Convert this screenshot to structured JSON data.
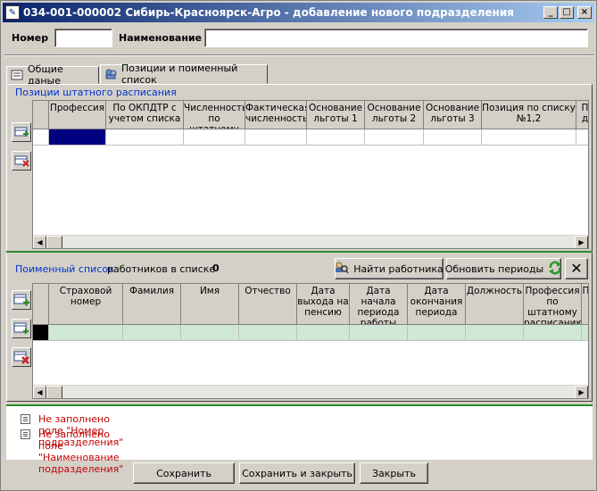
{
  "window": {
    "title": "034-001-000002 Сибирь-Красноярск-Агро - добавление нового подразделения",
    "controls": {
      "minimize": "_",
      "maximize": "□",
      "close": "×"
    }
  },
  "form": {
    "number_label": "Номер",
    "number_value": "",
    "name_label": "Наименование",
    "name_value": ""
  },
  "tabs": [
    {
      "label": "Общие даные",
      "icon": "document-icon"
    },
    {
      "label": "Позиции и поименный список",
      "icon": "users-icon"
    }
  ],
  "positions": {
    "caption": "Позиции штатного расписания",
    "columns": [
      "Профессия",
      "По ОКПДТР с\nучетом списка",
      "Численность\nпо штатному",
      "Фактическая\nчисленность",
      "Основание\nльготы 1",
      "Основание\nльготы 2",
      "Основание\nльготы 3",
      "Позиция по списку\n№1,2",
      "П\nд"
    ]
  },
  "employees": {
    "caption_link": "Поименный список",
    "count_label": "работников в списке",
    "count": "0",
    "find_button": "Найти работника",
    "update_button": "Обновить периоды",
    "columns": [
      "Страховой\nномер",
      "Фамилия",
      "Имя",
      "Отчество",
      "Дата\nвыхода на\nпенсию",
      "Дата начала\nпериода\nработы",
      "Дата\nокончания\nпериода",
      "Должность",
      "Профессия\nпо штатному\nрасписанию",
      "П"
    ]
  },
  "messages": [
    "Не заполнено поле \"Номер подразделения\"",
    "Не заполнено поле \"Наименование подразделения\""
  ],
  "footer": {
    "save": "Сохранить",
    "save_close": "Сохранить и закрыть",
    "close": "Закрыть"
  },
  "colors": {
    "selection": "#000080",
    "row_green": "#cfe8d3",
    "link_blue": "#0033cc",
    "error_red": "#c00000"
  }
}
